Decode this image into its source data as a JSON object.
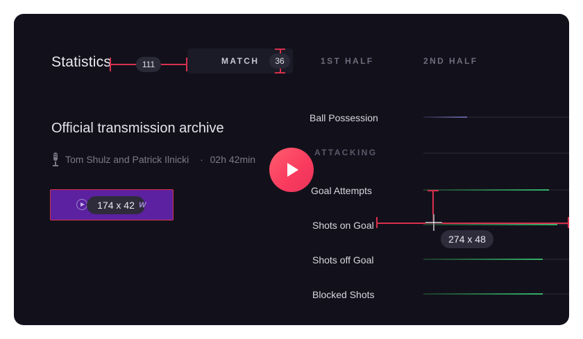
{
  "header": {
    "title": "Statistics",
    "tabs": [
      {
        "label": "MATCH",
        "active": true
      },
      {
        "label": "1ST HALF",
        "active": false
      },
      {
        "label": "2ND HALF",
        "active": false
      }
    ],
    "measure_width": "111",
    "measure_height": "36"
  },
  "archive": {
    "title": "Official transmission archive",
    "hosts": "Tom Shulz and Patrick Ilnicki",
    "separator": "·",
    "duration": "02h 42min",
    "button_measure": "174 x 42",
    "button_glyph": "W"
  },
  "stats": {
    "section_label": "ATTACKING",
    "rows": [
      {
        "label": "Ball Possession",
        "value": 0.3,
        "color": "#5f5f8a"
      },
      {
        "label": "Goal Attempts",
        "value": 0.86,
        "color": "#34b26a"
      },
      {
        "label": "Shots on Goal",
        "value": 0.92,
        "color": "#34b26a"
      },
      {
        "label": "Shots off Goal",
        "value": 0.82,
        "color": "#34b26a"
      },
      {
        "label": "Blocked Shots",
        "value": 0.82,
        "color": "#34b26a"
      }
    ],
    "measure_row": "274 x 48"
  },
  "colors": {
    "background": "#12111b",
    "accent": "#f93a5e",
    "measure": "#d9304d",
    "button": "#5b21a0"
  },
  "icons": [
    "mic-icon",
    "play-icon",
    "crosshair-icon"
  ]
}
